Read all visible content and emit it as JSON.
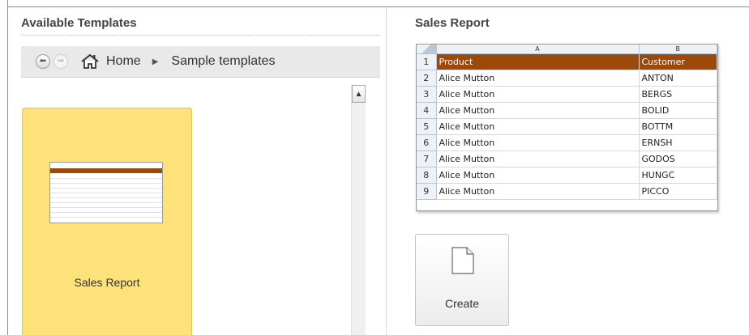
{
  "panel": {
    "title": "Available Templates"
  },
  "nav": {
    "back_icon": "back-arrow-icon",
    "forward_icon": "forward-arrow-icon",
    "home_icon": "home-icon",
    "home_label": "Home",
    "separator_icon": "chevron-right-icon",
    "current": "Sample templates"
  },
  "templates": [
    {
      "label": "Sales Report",
      "selected": true
    }
  ],
  "preview": {
    "title": "Sales Report",
    "sheet": {
      "columns": [
        "A",
        "B"
      ],
      "header_color": "#9c4a0c",
      "rows": [
        {
          "num": "1",
          "a": "Product",
          "b": "Customer"
        },
        {
          "num": "2",
          "a": "Alice Mutton",
          "b": "ANTON"
        },
        {
          "num": "3",
          "a": "Alice Mutton",
          "b": "BERGS"
        },
        {
          "num": "4",
          "a": "Alice Mutton",
          "b": "BOLID"
        },
        {
          "num": "5",
          "a": "Alice Mutton",
          "b": "BOTTM"
        },
        {
          "num": "6",
          "a": "Alice Mutton",
          "b": "ERNSH"
        },
        {
          "num": "7",
          "a": "Alice Mutton",
          "b": "GODOS"
        },
        {
          "num": "8",
          "a": "Alice Mutton",
          "b": "HUNGC"
        },
        {
          "num": "9",
          "a": "Alice Mutton",
          "b": "PICCO"
        }
      ]
    }
  },
  "actions": {
    "create_label": "Create",
    "create_icon": "blank-document-icon"
  },
  "colors": {
    "selected_tile": "#fde27a",
    "tile_border": "#e8c14a"
  }
}
